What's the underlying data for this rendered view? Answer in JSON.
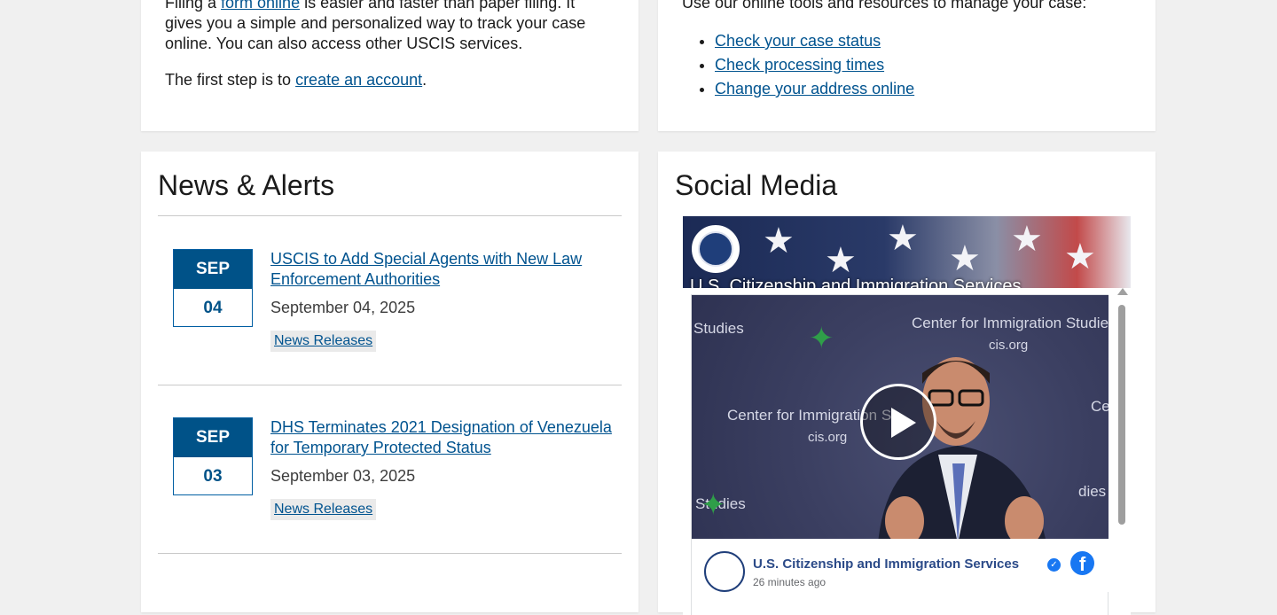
{
  "filing_card": {
    "p1_before": "Filing a ",
    "p1_link": "form online",
    "p1_after": " is easier and faster than paper filing. It gives you a simple and personalized way to track your case online. You can also access other USCIS services.",
    "p2_before": "The first step is to ",
    "p2_link": "create an account",
    "p2_after": "."
  },
  "tools_card": {
    "intro": "Use our online tools and resources to manage your case:",
    "links": [
      "Check your case status",
      "Check processing times",
      "Change your address online"
    ]
  },
  "news_card": {
    "heading": "News & Alerts",
    "items": [
      {
        "month": "SEP",
        "day": "04",
        "title": "USCIS to Add Special Agents with New Law Enforcement Authorities",
        "date": "September 04, 2025",
        "tag": "News Releases"
      },
      {
        "month": "SEP",
        "day": "03",
        "title": "DHS Terminates 2021 Designation of Venezuela for Temporary Protected Status",
        "date": "September 03, 2025",
        "tag": "News Releases"
      }
    ]
  },
  "social_card": {
    "heading": "Social Media",
    "cover_page_name": "U.S. Citizenship and Immigration Services",
    "video_texts": {
      "studies": "Studies",
      "center_top": "Center for Immigration Studies",
      "cis_top": "cis.org",
      "center_mid": "Center for Immigration S",
      "cis_mid": "cis.org",
      "ce": "Ce",
      "dies": "dies",
      "studies_bottom": "Studies"
    },
    "post_page_name": "U.S. Citizenship and Immigration Services",
    "post_time": "26 minutes ago",
    "facebook_logo_letter": "f",
    "colors": {
      "facebook_blue": "#1877f2",
      "link": "#00538f",
      "date_box": "#005288"
    }
  }
}
